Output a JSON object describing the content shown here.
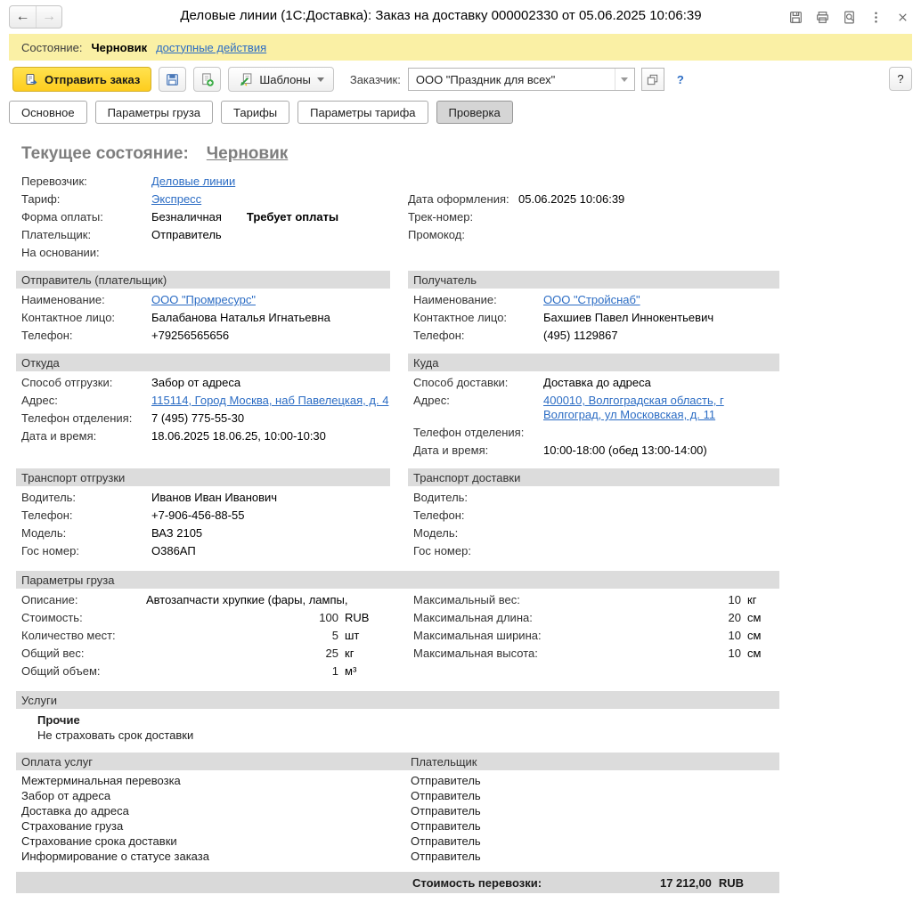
{
  "window": {
    "title": "Деловые линии (1С:Доставка): Заказ на доставку 000002330 от 05.06.2025 10:06:39",
    "nav": {
      "back": "←",
      "forward": "→"
    }
  },
  "status_bar": {
    "label": "Состояние:",
    "value": "Черновик",
    "actions_link": "доступные действия"
  },
  "toolbar": {
    "send_button": "Отправить заказ",
    "templates_button": "Шаблоны",
    "customer_label": "Заказчик:",
    "customer_value": "ООО \"Праздник для всех\"",
    "inline_help": "?",
    "help_button": "?"
  },
  "tabs": [
    "Основное",
    "Параметры груза",
    "Тарифы",
    "Параметры тарифа",
    "Проверка"
  ],
  "active_tab": "Проверка",
  "page": {
    "state_label": "Текущее состояние:",
    "state_value": "Черновик"
  },
  "main_info": {
    "left": [
      {
        "label": "Перевозчик:",
        "value": "Деловые линии",
        "link": true
      },
      {
        "label": "Тариф:",
        "value": "Экспресс",
        "link": true
      },
      {
        "label": "Форма оплаты:",
        "value": "Безналичная",
        "extra": "Требует оплаты"
      },
      {
        "label": "Плательщик:",
        "value": "Отправитель"
      },
      {
        "label": "На основании:",
        "value": ""
      }
    ],
    "right": [
      {
        "label": "Дата оформления:",
        "value": "05.06.2025 10:06:39"
      },
      {
        "label": "Трек-номер:",
        "value": ""
      },
      {
        "label": "Промокод:",
        "value": ""
      }
    ]
  },
  "sender": {
    "title": "Отправитель (плательщик)",
    "rows": [
      {
        "label": "Наименование:",
        "value": "ООО \"Промресурс\"",
        "link": true
      },
      {
        "label": "Контактное лицо:",
        "value": "Балабанова Наталья Игнатьевна"
      },
      {
        "label": "Телефон:",
        "value": "+79256565656"
      }
    ]
  },
  "receiver": {
    "title": "Получатель",
    "rows": [
      {
        "label": "Наименование:",
        "value": "ООО \"Стройснаб\"",
        "link": true
      },
      {
        "label": "Контактное лицо:",
        "value": "Бахшиев Павел Иннокентьевич"
      },
      {
        "label": "Телефон:",
        "value": "(495) 1129867"
      }
    ]
  },
  "from": {
    "title": "Откуда",
    "rows": [
      {
        "label": "Способ отгрузки:",
        "value": "Забор от адреса"
      },
      {
        "label": "Адрес:",
        "value": "115114, Город Москва, наб Павелецкая, д. 4",
        "link": true
      },
      {
        "label": "Телефон отделения:",
        "value": "7 (495) 775-55-30"
      },
      {
        "label": "Дата и время:",
        "value": "18.06.2025 18.06.25, 10:00-10:30"
      }
    ]
  },
  "to": {
    "title": "Куда",
    "rows": [
      {
        "label": "Способ доставки:",
        "value": "Доставка до адреса"
      },
      {
        "label": "Адрес:",
        "value": "400010, Волгоградская область, г Волгоград, ул Московская, д. 11",
        "link": true
      },
      {
        "label": "Телефон отделения:",
        "value": ""
      },
      {
        "label": "Дата и время:",
        "value": "10:00-18:00 (обед 13:00-14:00)"
      }
    ]
  },
  "transport_pickup": {
    "title": "Транспорт отгрузки",
    "rows": [
      {
        "label": "Водитель:",
        "value": "Иванов Иван Иванович"
      },
      {
        "label": "Телефон:",
        "value": "+7-906-456-88-55"
      },
      {
        "label": "Модель:",
        "value": "ВАЗ 2105"
      },
      {
        "label": "Гос номер:",
        "value": "О386АП"
      }
    ]
  },
  "transport_delivery": {
    "title": "Транспорт доставки",
    "rows": [
      {
        "label": "Водитель:",
        "value": ""
      },
      {
        "label": "Телефон:",
        "value": ""
      },
      {
        "label": "Модель:",
        "value": ""
      },
      {
        "label": "Гос номер:",
        "value": ""
      }
    ]
  },
  "cargo": {
    "title": "Параметры груза",
    "left": [
      {
        "label": "Описание:",
        "text": "Автозапчасти хрупкие (фары, лампы,"
      },
      {
        "label": "Стоимость:",
        "num": "100",
        "unit": "RUB"
      },
      {
        "label": "Количество мест:",
        "num": "5",
        "unit": "шт"
      },
      {
        "label": "Общий вес:",
        "num": "25",
        "unit": "кг"
      },
      {
        "label": "Общий объем:",
        "num": "1",
        "unit": "м³"
      }
    ],
    "right": [
      {
        "label": "Максимальный вес:",
        "num": "10",
        "unit": "кг"
      },
      {
        "label": "Максимальная длина:",
        "num": "20",
        "unit": "см"
      },
      {
        "label": "Максимальная ширина:",
        "num": "10",
        "unit": "см"
      },
      {
        "label": "Максимальная высота:",
        "num": "10",
        "unit": "см"
      }
    ]
  },
  "services": {
    "title": "Услуги",
    "group": "Прочие",
    "items": [
      "Не страховать срок доставки"
    ]
  },
  "payment": {
    "title": "Оплата услуг",
    "payer_header": "Плательщик",
    "rows": [
      {
        "service": "Межтерминальная перевозка",
        "payer": "Отправитель"
      },
      {
        "service": "Забор от адреса",
        "payer": "Отправитель"
      },
      {
        "service": "Доставка до адреса",
        "payer": "Отправитель"
      },
      {
        "service": "Страхование груза",
        "payer": "Отправитель"
      },
      {
        "service": "Страхование срока доставки",
        "payer": "Отправитель"
      },
      {
        "service": "Информирование о статусе заказа",
        "payer": "Отправитель"
      }
    ]
  },
  "total": {
    "label": "Стоимость перевозки:",
    "value": "17 212,00",
    "currency": "RUB"
  },
  "colors": {
    "status_bar_bg": "#faf0a5",
    "send_button_bg": "#ffd83a",
    "section_header_bg": "#dcdcdc",
    "link": "#2b6cc4"
  }
}
